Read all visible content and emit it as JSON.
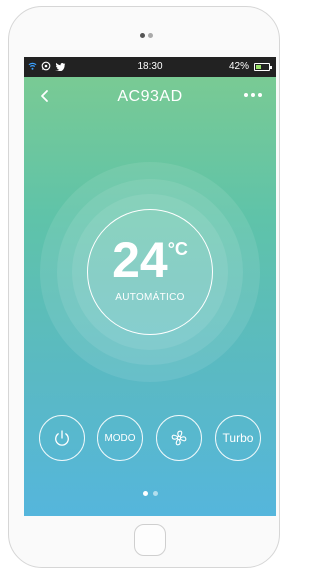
{
  "status_bar": {
    "time": "18:30",
    "battery_percent": "42%",
    "battery_level": 0.42,
    "notification_icons": [
      "wifi-icon",
      "whatsapp-icon",
      "twitter-icon"
    ]
  },
  "header": {
    "title": "AC93AD",
    "back_icon": "chevron-left-icon",
    "menu_icon": "more-horizontal-icon"
  },
  "thermostat": {
    "temperature": "24",
    "unit": "°C",
    "mode": "AUTOMÁTICO"
  },
  "controls": {
    "power_icon": "power-icon",
    "mode_label": "MODO",
    "fan_icon": "fan-icon",
    "turbo_label": "Turbo"
  },
  "pager": {
    "pages": 2,
    "active_page": 1
  },
  "colors": {
    "gradient_top": "#7dcb91",
    "gradient_bottom": "#55b6dc",
    "status_bar": "#222222",
    "battery_fill": "#9be36a"
  }
}
